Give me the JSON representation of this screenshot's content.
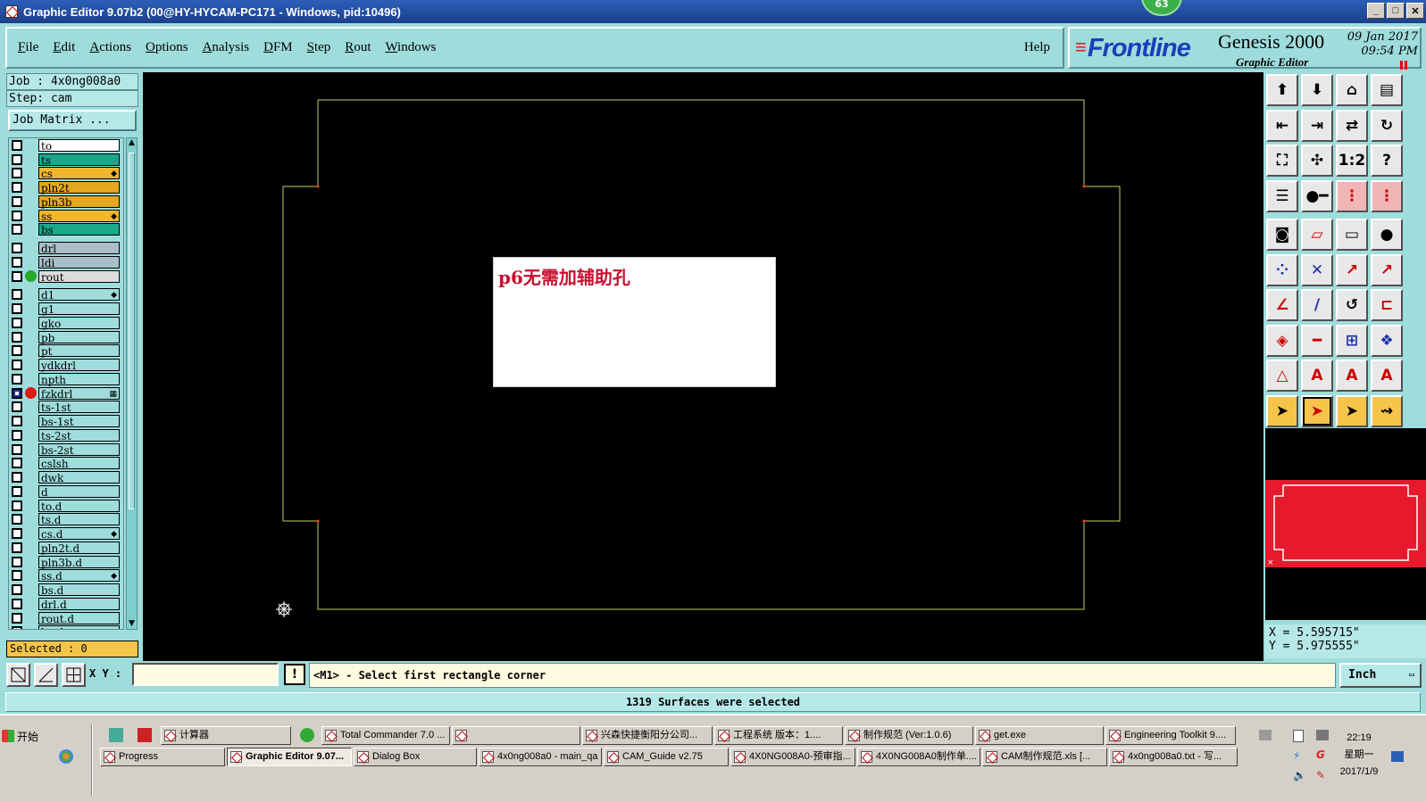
{
  "window": {
    "title": "Graphic Editor 9.07b2 (00@HY-HYCAM-PC171 - Windows, pid:10496)",
    "badge": "63",
    "controls": [
      "_",
      "□",
      "✕"
    ]
  },
  "menu": {
    "items": [
      {
        "label": "File",
        "ul": "F",
        "rest": "ile"
      },
      {
        "label": "Edit",
        "ul": "E",
        "rest": "dit"
      },
      {
        "label": "Actions",
        "ul": "A",
        "rest": "ctions"
      },
      {
        "label": "Options",
        "ul": "O",
        "rest": "ptions"
      },
      {
        "label": "Analysis",
        "ul": "A",
        "rest": "nalysis"
      },
      {
        "label": "DFM",
        "ul": "D",
        "rest": "FM"
      },
      {
        "label": "Step",
        "ul": "S",
        "rest": "tep"
      },
      {
        "label": "Rout",
        "ul": "R",
        "rest": "out"
      },
      {
        "label": "Windows",
        "ul": "W",
        "rest": "indows"
      }
    ],
    "help": "Help"
  },
  "brand": {
    "logo": "Frontline",
    "product": "Genesis 2000",
    "subtitle": "Graphic Editor",
    "date_line1": "09 Jan 2017",
    "date_line2": "09:54 PM"
  },
  "job": {
    "job_label": "Job  :  4x0ng008a0",
    "step_label": "Step:  cam",
    "matrix_button": "Job Matrix ..."
  },
  "layers": [
    {
      "name": "to",
      "color": "#ffffff",
      "dot": "",
      "flag": "",
      "gap": false
    },
    {
      "name": "ts",
      "color": "#1aa88a",
      "dot": "",
      "flag": "",
      "gap": false
    },
    {
      "name": "cs",
      "color": "#f2b52e",
      "dot": "",
      "flag": "◆",
      "gap": false
    },
    {
      "name": "pln2t",
      "color": "#e3a81e",
      "dot": "",
      "flag": "",
      "gap": false
    },
    {
      "name": "pln3b",
      "color": "#e3a81e",
      "dot": "",
      "flag": "",
      "gap": false
    },
    {
      "name": "ss",
      "color": "#f2b52e",
      "dot": "",
      "flag": "◆",
      "gap": false
    },
    {
      "name": "bs",
      "color": "#1aa88a",
      "dot": "",
      "flag": "",
      "gap": false
    },
    {
      "name": "drl",
      "color": "#a9bec8",
      "dot": "",
      "flag": "",
      "gap": true
    },
    {
      "name": "ldi",
      "color": "#a9bec8",
      "dot": "",
      "flag": "",
      "gap": false
    },
    {
      "name": "rout",
      "color": "#dcdcdc",
      "dot": "#2aa82a",
      "flag": "",
      "gap": false
    },
    {
      "name": "d1",
      "color": "#9fdcdc",
      "dot": "",
      "flag": "◆",
      "gap": true
    },
    {
      "name": "g1",
      "color": "#9fdcdc",
      "dot": "",
      "flag": "",
      "gap": false
    },
    {
      "name": "gko",
      "color": "#9fdcdc",
      "dot": "",
      "flag": "",
      "gap": false
    },
    {
      "name": "pb",
      "color": "#9fdcdc",
      "dot": "",
      "flag": "",
      "gap": false
    },
    {
      "name": "pt",
      "color": "#9fdcdc",
      "dot": "",
      "flag": "",
      "gap": false
    },
    {
      "name": "ydkdrl",
      "color": "#9fdcdc",
      "dot": "",
      "flag": "",
      "gap": false
    },
    {
      "name": "npth",
      "color": "#9fdcdc",
      "dot": "",
      "flag": "",
      "gap": false
    },
    {
      "name": "fzkdrl",
      "color": "#9fdcdc",
      "dot": "#e01818",
      "flag": "▦",
      "gap": false,
      "selected": true
    },
    {
      "name": "ts-1st",
      "color": "#9fdcdc",
      "dot": "",
      "flag": "",
      "gap": false
    },
    {
      "name": "bs-1st",
      "color": "#9fdcdc",
      "dot": "",
      "flag": "",
      "gap": false
    },
    {
      "name": "ts-2st",
      "color": "#9fdcdc",
      "dot": "",
      "flag": "",
      "gap": false
    },
    {
      "name": "bs-2st",
      "color": "#9fdcdc",
      "dot": "",
      "flag": "",
      "gap": false
    },
    {
      "name": "cslsh",
      "color": "#9fdcdc",
      "dot": "",
      "flag": "",
      "gap": false
    },
    {
      "name": "dwk",
      "color": "#9fdcdc",
      "dot": "",
      "flag": "",
      "gap": false
    },
    {
      "name": "d",
      "color": "#9fdcdc",
      "dot": "",
      "flag": "",
      "gap": false
    },
    {
      "name": "to.d",
      "color": "#9fdcdc",
      "dot": "",
      "flag": "",
      "gap": false
    },
    {
      "name": "ts.d",
      "color": "#9fdcdc",
      "dot": "",
      "flag": "",
      "gap": false
    },
    {
      "name": "cs.d",
      "color": "#9fdcdc",
      "dot": "",
      "flag": "◆",
      "gap": false
    },
    {
      "name": "pln2t.d",
      "color": "#9fdcdc",
      "dot": "",
      "flag": "",
      "gap": false
    },
    {
      "name": "pln3b.d",
      "color": "#9fdcdc",
      "dot": "",
      "flag": "",
      "gap": false
    },
    {
      "name": "ss.d",
      "color": "#9fdcdc",
      "dot": "",
      "flag": "◆",
      "gap": false
    },
    {
      "name": "bs.d",
      "color": "#9fdcdc",
      "dot": "",
      "flag": "",
      "gap": false
    },
    {
      "name": "drl.d",
      "color": "#9fdcdc",
      "dot": "",
      "flag": "",
      "gap": false
    },
    {
      "name": "rout.d",
      "color": "#9fdcdc",
      "dot": "",
      "flag": "",
      "gap": false
    },
    {
      "name": "bs.d",
      "color": "#9fdcdc",
      "dot": "",
      "flag": "",
      "gap": false
    }
  ],
  "selected_count": "Selected : 0",
  "popup_text": "p6无需加辅助孔",
  "coords": {
    "x": "X  =  5.595715\"",
    "y": "Y  =  5.975555\""
  },
  "command": {
    "xy_label": "X Y :",
    "xy_value": "",
    "prompt": "<M1> - Select first rectangle corner",
    "units": "Inch"
  },
  "status_message": "1319 Surfaces were selected",
  "taskbar": {
    "start": "开始",
    "row1": [
      {
        "label": "计算器",
        "active": false
      },
      {
        "label": "Total Commander 7.0 ...",
        "active": false
      },
      {
        "label": "",
        "active": false
      },
      {
        "label": "兴森快捷衡阳分公司...",
        "active": false
      },
      {
        "label": "工程系统   版本：1....",
        "active": false
      },
      {
        "label": "制作规范 (Ver:1.0.6)",
        "active": false
      },
      {
        "label": "get.exe",
        "active": false
      },
      {
        "label": "Engineering Toolkit 9....",
        "active": false
      }
    ],
    "row2": [
      {
        "label": "Progress",
        "active": false
      },
      {
        "label": "Graphic Editor 9.07...",
        "active": true
      },
      {
        "label": "Dialog Box",
        "active": false
      },
      {
        "label": "4x0ng008a0 - main_qa",
        "active": false
      },
      {
        "label": "CAM_Guide v2.75",
        "active": false
      },
      {
        "label": "4X0NG008A0-预审指...",
        "active": false
      },
      {
        "label": "4X0NG008A0制作单....",
        "active": false
      },
      {
        "label": "CAM制作规范.xls  [...",
        "active": false
      },
      {
        "label": "4x0ng008a0.txt - 写...",
        "active": false
      }
    ],
    "clock_time": "22:19",
    "clock_day": "星期一",
    "clock_date": "2017/1/9"
  }
}
